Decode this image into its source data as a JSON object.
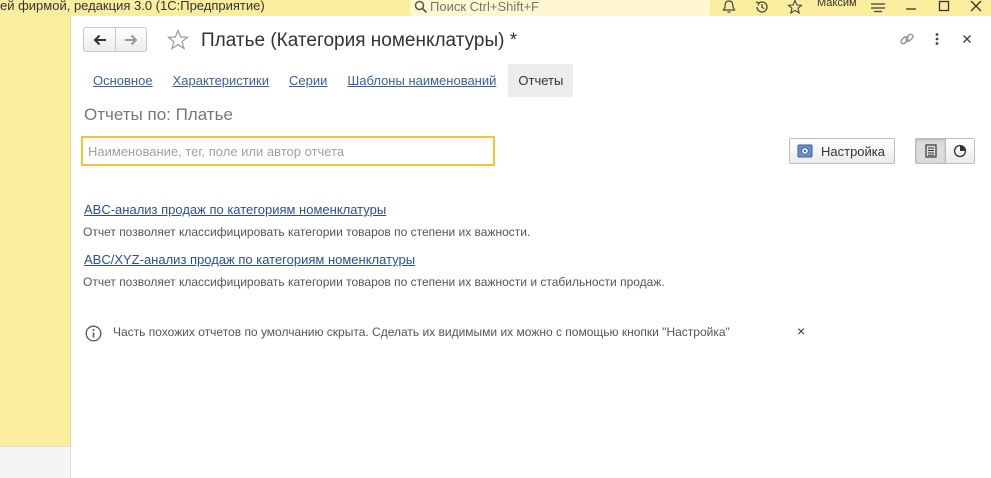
{
  "titlebar": {
    "app_title": "ей фирмой, редакция 3.0  (1С:Предприятие)",
    "search_placeholder": "Поиск Ctrl+Shift+F",
    "user_name": "Максим"
  },
  "form": {
    "title": "Платье (Категория номенклатуры) *",
    "tabs": [
      {
        "label": "Основное"
      },
      {
        "label": "Характеристики"
      },
      {
        "label": "Серии"
      },
      {
        "label": "Шаблоны наименований"
      },
      {
        "label": "Отчеты"
      }
    ],
    "active_tab": "Отчеты",
    "subtitle": "Отчеты по: Платье",
    "search_placeholder": "Наименование, тег, поле или автор отчета",
    "settings_label": "Настройка",
    "reports": [
      {
        "title": "ABC-анализ продаж по категориям номенклатуры",
        "description": "Отчет позволяет классифицировать категории товаров по степени их важности."
      },
      {
        "title": "ABC/XYZ-анализ продаж по категориям номенклатуры",
        "description": "Отчет позволяет классифицировать категории товаров по степени их важности и стабильности продаж."
      }
    ],
    "info_message": "Часть похожих отчетов по умолчанию скрыта. Сделать их видимыми их можно с помощью кнопки \"Настройка\"",
    "info_close": "×"
  },
  "colors": {
    "app_background": "#fbed9e",
    "link": "#2a4f9a",
    "search_focus_border": "#f5c533",
    "active_tab_bg": "#ececec"
  }
}
